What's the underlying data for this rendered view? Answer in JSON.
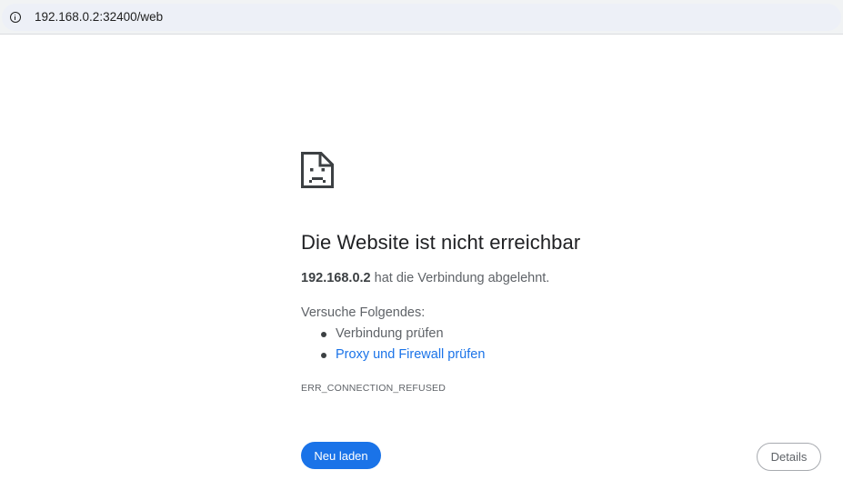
{
  "browser": {
    "url": "192.168.0.2:32400/web",
    "site_info_icon": "info-icon"
  },
  "error_page": {
    "icon": "sad-page-icon",
    "title": "Die Website ist nicht erreichbar",
    "summary_host": "192.168.0.2",
    "summary_text": " hat die Verbindung abgelehnt.",
    "suggestions_heading": "Versuche Folgendes:",
    "suggestions": [
      {
        "label": "Verbindung prüfen",
        "is_link": false
      },
      {
        "label": "Proxy und Firewall prüfen",
        "is_link": true
      }
    ],
    "error_code": "ERR_CONNECTION_REFUSED",
    "reload_label": "Neu laden",
    "details_label": "Details"
  },
  "colors": {
    "accent": "#1a73e8",
    "text_primary": "#202124",
    "text_secondary": "#5f6368",
    "address_bar_bg": "#edf0f7"
  }
}
